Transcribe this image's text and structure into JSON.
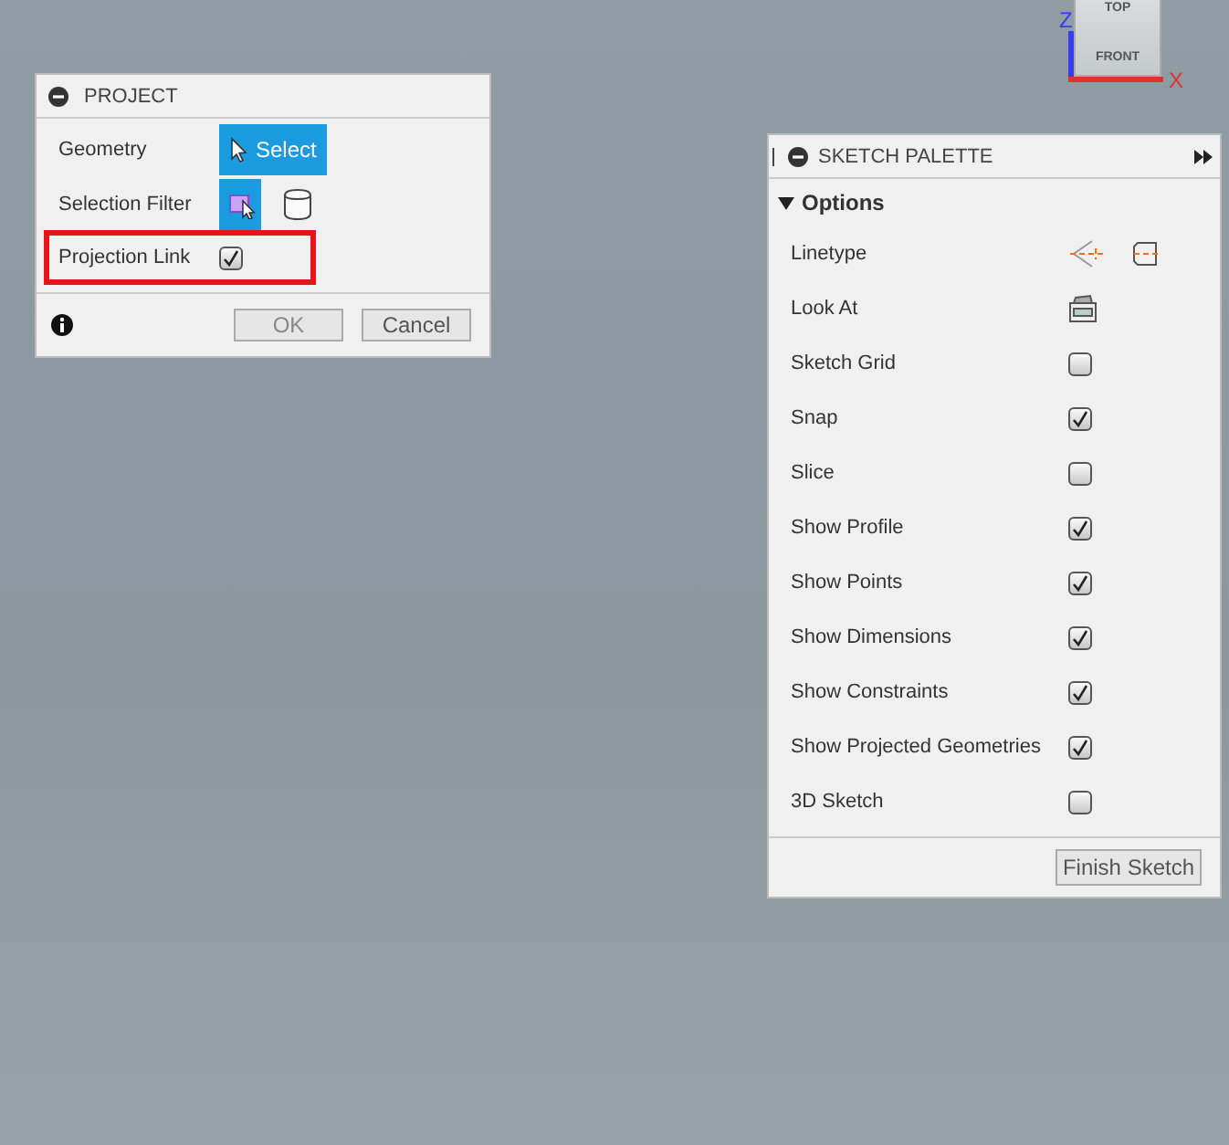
{
  "view_cube": {
    "faces": [
      "TOP",
      "FRONT"
    ],
    "axes": [
      {
        "label": "Z",
        "color": "#3a3af0"
      },
      {
        "label": "X",
        "color": "#e03030"
      }
    ]
  },
  "project": {
    "title": "PROJECT",
    "rows": [
      {
        "kind": "button",
        "label": "Geometry",
        "button": "Select"
      },
      {
        "kind": "filter",
        "label": "Selection Filter",
        "filters": [
          {
            "selected": true
          },
          {
            "selected": false
          }
        ]
      },
      {
        "kind": "checkbox",
        "label": "Projection Link",
        "checked": true,
        "highlighted": true
      }
    ],
    "buttons": [
      {
        "label": "OK",
        "disabled": true
      },
      {
        "label": "Cancel",
        "disabled": false
      }
    ]
  },
  "palette": {
    "title": "SKETCH PALETTE",
    "section": {
      "label": "Options",
      "expanded": true
    },
    "rows": [
      {
        "kind": "linetype",
        "label": "Linetype"
      },
      {
        "kind": "lookat",
        "label": "Look At"
      },
      {
        "kind": "checkbox",
        "label": "Sketch Grid",
        "checked": false
      },
      {
        "kind": "checkbox",
        "label": "Snap",
        "checked": true
      },
      {
        "kind": "checkbox",
        "label": "Slice",
        "checked": false
      },
      {
        "kind": "checkbox",
        "label": "Show Profile",
        "checked": true
      },
      {
        "kind": "checkbox",
        "label": "Show Points",
        "checked": true
      },
      {
        "kind": "checkbox",
        "label": "Show Dimensions",
        "checked": true
      },
      {
        "kind": "checkbox",
        "label": "Show Constraints",
        "checked": true
      },
      {
        "kind": "checkbox",
        "label": "Show Projected Geometries",
        "checked": true
      },
      {
        "kind": "checkbox",
        "label": "3D Sketch",
        "checked": false
      }
    ],
    "finish": "Finish Sketch"
  }
}
